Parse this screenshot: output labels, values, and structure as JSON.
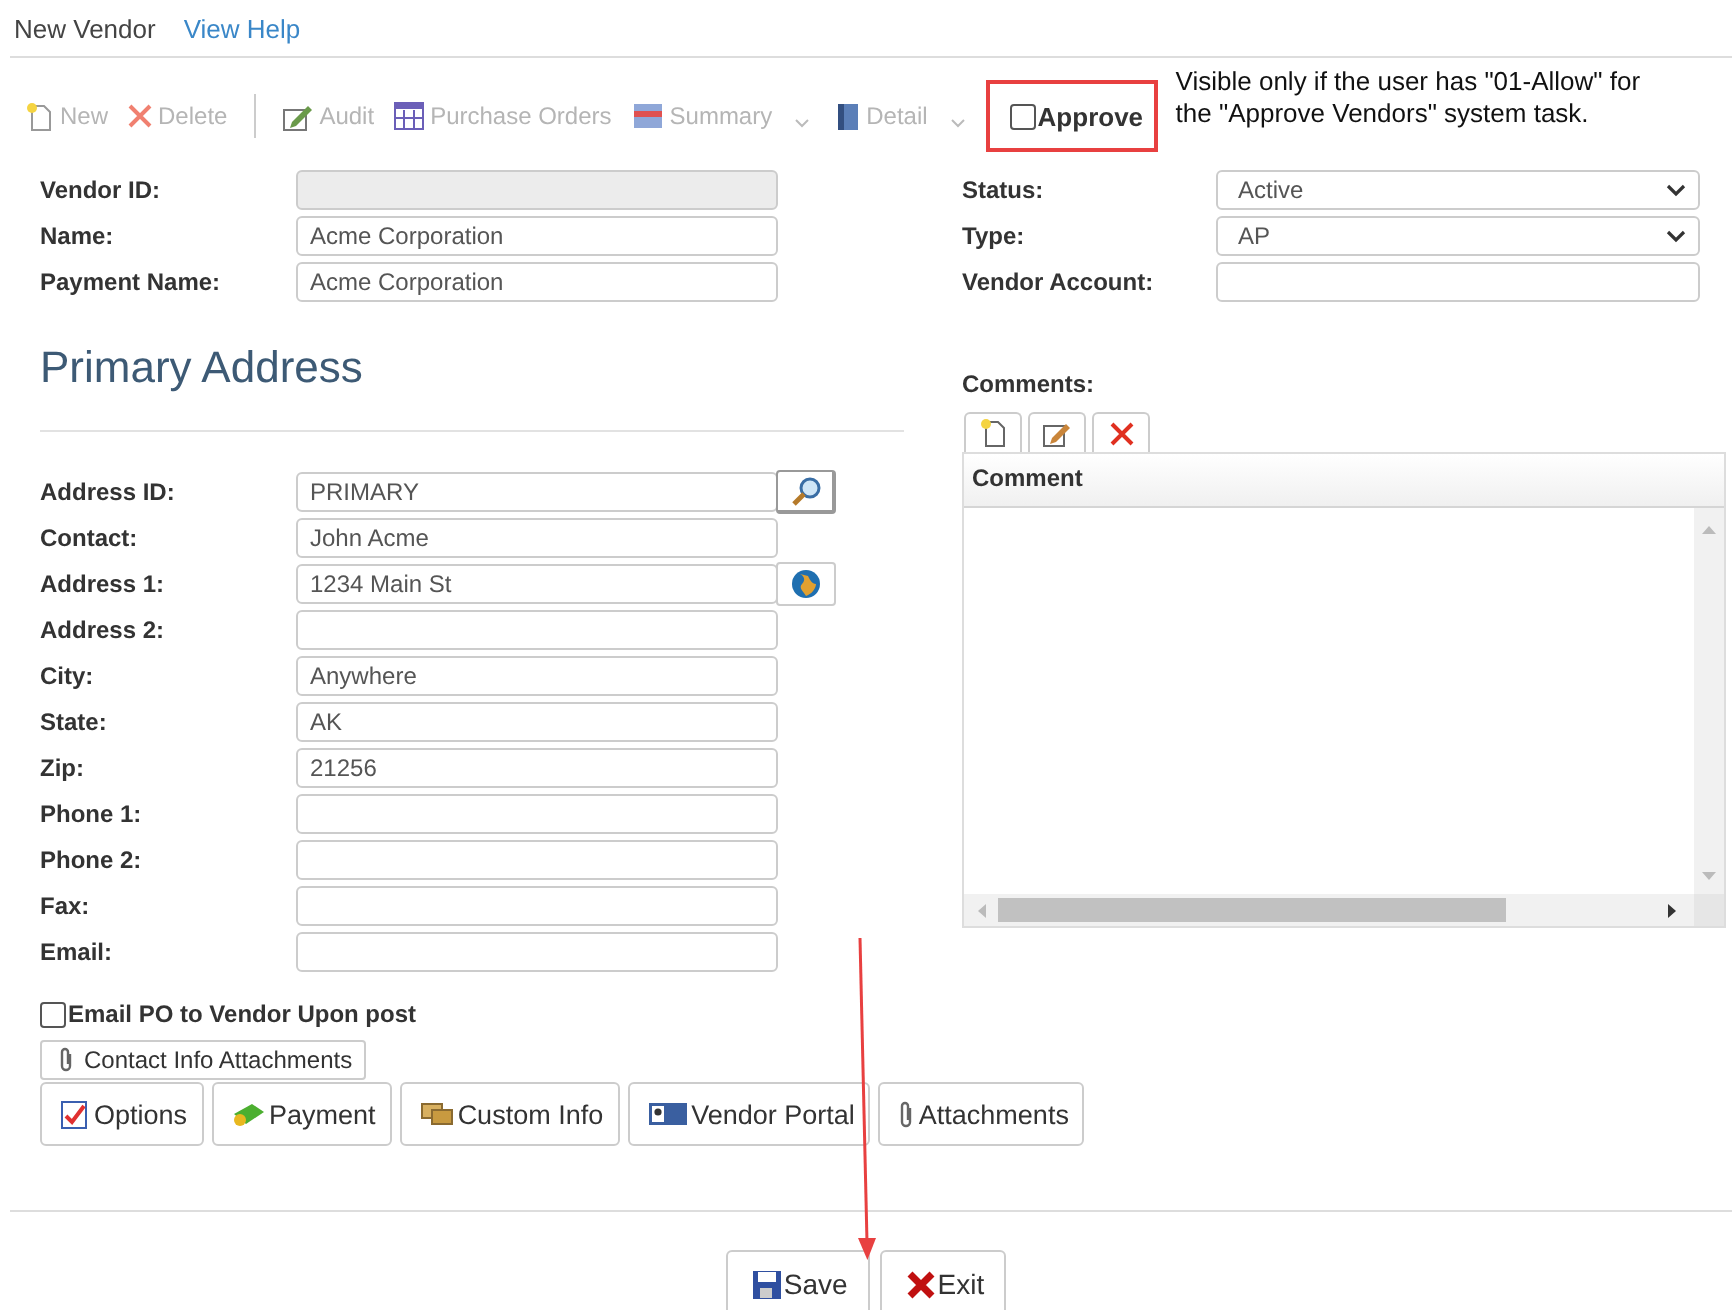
{
  "header": {
    "title": "New Vendor",
    "help_link": "View Help"
  },
  "toolbar": [
    {
      "kind": "button",
      "label": "New",
      "disabled": true,
      "dropdown": false
    },
    {
      "kind": "button",
      "label": "Delete",
      "disabled": true,
      "dropdown": false
    },
    {
      "kind": "separator"
    },
    {
      "kind": "button",
      "label": "Audit",
      "disabled": true,
      "dropdown": false
    },
    {
      "kind": "button",
      "label": "Purchase Orders",
      "disabled": true,
      "dropdown": false
    },
    {
      "kind": "button",
      "label": "Summary",
      "disabled": true,
      "dropdown": true
    },
    {
      "kind": "button",
      "label": "Detail",
      "disabled": true,
      "dropdown": true
    }
  ],
  "approve": {
    "label": "Approve",
    "checked": false
  },
  "annotation": "Visible only if the user has \"01-Allow\" for the \"Approve Vendors\" system task.",
  "vendor_fields": [
    {
      "label": "Vendor ID:",
      "kind": "text",
      "disabled": true
    },
    {
      "label": "Name:",
      "kind": "text",
      "disabled": false,
      "value": "Acme Corporation"
    },
    {
      "label": "Payment Name:",
      "kind": "text",
      "disabled": false,
      "value": "Acme Corporation"
    }
  ],
  "vendor_fields_right": [
    {
      "label": "Status:",
      "kind": "select",
      "disabled": false,
      "value": "Active"
    },
    {
      "label": "Type:",
      "kind": "select",
      "disabled": false,
      "value": "AP"
    },
    {
      "label": "Vendor Account:",
      "kind": "text",
      "disabled": false
    }
  ],
  "address": {
    "heading": "Primary Address",
    "fields": [
      {
        "label": "Address ID:",
        "kind": "lookup",
        "value": "PRIMARY"
      },
      {
        "label": "Contact:",
        "kind": "text",
        "value": "John Acme"
      },
      {
        "label": "Address 1:",
        "kind": "map",
        "value": "1234 Main St"
      },
      {
        "label": "Address 2:",
        "kind": "text"
      },
      {
        "label": "City:",
        "kind": "text",
        "value": "Anywhere"
      },
      {
        "label": "State:",
        "kind": "text",
        "value": "AK"
      },
      {
        "label": "Zip:",
        "kind": "text",
        "value": "21256"
      },
      {
        "label": "Phone 1:",
        "kind": "text"
      },
      {
        "label": "Phone 2:",
        "kind": "text"
      },
      {
        "label": "Fax:",
        "kind": "text"
      },
      {
        "label": "Email:",
        "kind": "text"
      }
    ]
  },
  "comments": {
    "label": "Comments:",
    "column": "Comment"
  },
  "email_po": {
    "label": "Email PO to Vendor Upon post",
    "checked": false
  },
  "contact_attachments": "Contact Info Attachments",
  "section_buttons": [
    "Options",
    "Payment",
    "Custom Info",
    "Vendor Portal",
    "Attachments"
  ],
  "footer_buttons": [
    "Save",
    "Exit"
  ]
}
